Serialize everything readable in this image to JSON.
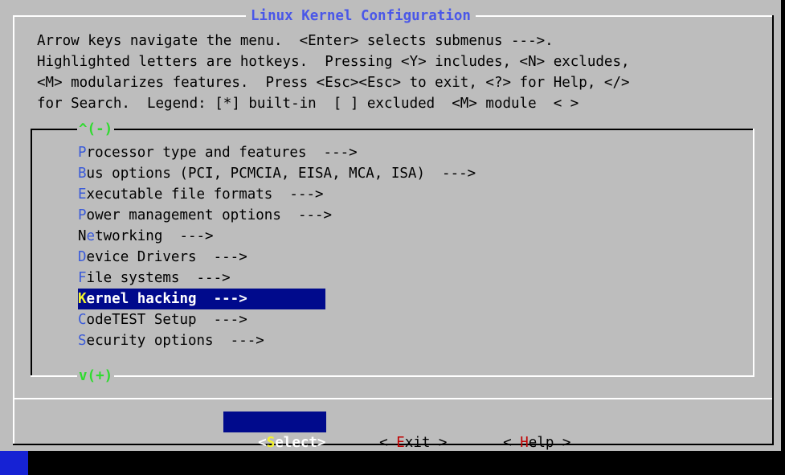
{
  "window": {
    "title": "Linux Kernel Configuration"
  },
  "help_text": [
    "Arrow keys navigate the menu.  <Enter> selects submenus --->.",
    "Highlighted letters are hotkeys.  Pressing <Y> includes, <N> excludes,",
    "<M> modularizes features.  Press <Esc><Esc> to exit, <?> for Help, </>",
    "for Search.  Legend: [*] built-in  [ ] excluded  <M> module  < >"
  ],
  "menu": {
    "scroll_up": "^(-)",
    "scroll_down": "v(+)",
    "selected_index": 7,
    "items": [
      {
        "hotkey": "P",
        "rest": "rocessor type and features  --->"
      },
      {
        "hotkey": "B",
        "rest": "us options (PCI, PCMCIA, EISA, MCA, ISA)  --->"
      },
      {
        "hotkey": "E",
        "rest": "xecutable file formats  --->"
      },
      {
        "hotkey": "P",
        "rest": "ower management options  --->"
      },
      {
        "prefix": "N",
        "hotkey": "e",
        "rest": "tworking  --->"
      },
      {
        "hotkey": "D",
        "rest": "evice Drivers  --->"
      },
      {
        "hotkey": "F",
        "rest": "ile systems  --->"
      },
      {
        "hotkey": "K",
        "rest": "ernel hacking  --->"
      },
      {
        "hotkey": "C",
        "rest": "odeTEST Setup  --->"
      },
      {
        "hotkey": "S",
        "rest": "ecurity options  --->"
      }
    ]
  },
  "buttons": {
    "select": {
      "open": "<",
      "hotkey": "S",
      "rest": "elect>"
    },
    "exit": {
      "open": "< ",
      "hotkey": "E",
      "rest": "xit >"
    },
    "help": {
      "open": "< ",
      "hotkey": "H",
      "rest": "elp >"
    }
  },
  "colors": {
    "background": "#bdbdbd",
    "title": "#4a57e8",
    "highlight_bg": "#000a8c",
    "hotkey": "#3b5bd8",
    "selected_hotkey": "#f4f42e",
    "button_hotkey": "#c00000",
    "scroll_indicator": "#2fdb2f"
  }
}
